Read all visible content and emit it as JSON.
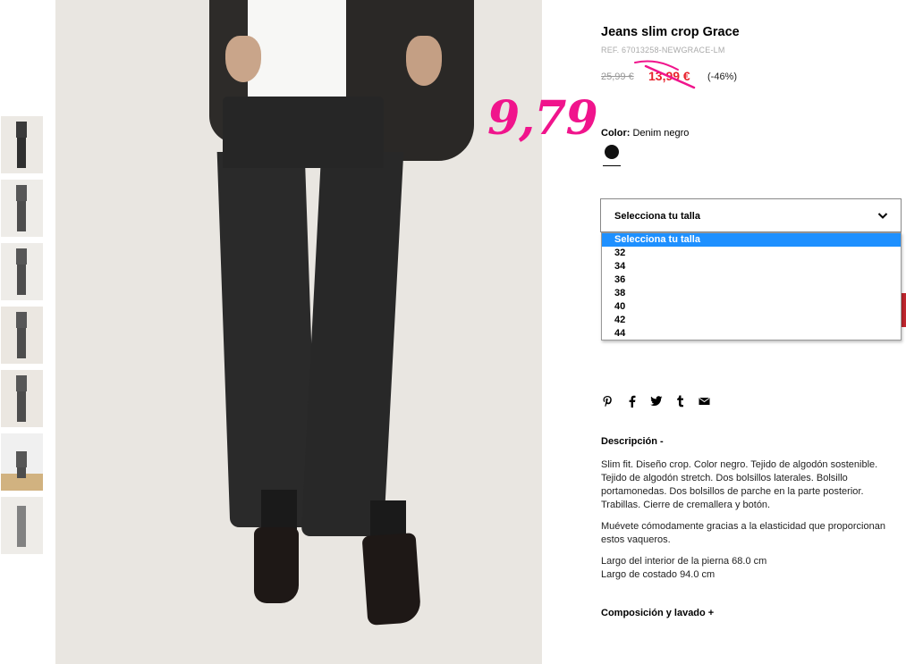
{
  "product": {
    "title": "Jeans slim crop Grace",
    "ref": "REF. 67013258-NEWGRACE-LM",
    "old_price": "25,99 €",
    "new_price": "13,99 €",
    "discount": "(-46%)",
    "handwritten_price": "9,79",
    "color_label": "Color:",
    "color_value": "Denim negro",
    "colors": {
      "swatch": "#111111",
      "price_red": "#e8232d",
      "handwritten": "#f0148c",
      "select_highlight": "#1e90ff"
    }
  },
  "size_select": {
    "label": "Selecciona tu talla",
    "options": [
      "Selecciona tu talla",
      "32",
      "34",
      "36",
      "38",
      "40",
      "42",
      "44"
    ],
    "selected_index": 0
  },
  "share_icons": [
    "pinterest-icon",
    "facebook-icon",
    "twitter-icon",
    "tumblr-icon",
    "email-icon"
  ],
  "description": {
    "title": "Descripción -",
    "paragraphs": [
      "Slim fit. Diseño crop. Color negro. Tejido de algodón sostenible. Tejido de algodón stretch. Dos bolsillos laterales. Bolsillo portamonedas. Dos bolsillos de parche en la parte posterior. Trabillas. Cierre de cremallera y botón.",
      "Muévete cómodamente gracias a la elasticidad que proporcionan estos vaqueros."
    ],
    "measure_1": "Largo del interior de la pierna 68.0 cm",
    "measure_2": "Largo de costado 94.0 cm"
  },
  "composition": {
    "title": "Composición y lavado +"
  },
  "gallery": {
    "thumbnail_count": 7,
    "active_index": 0
  }
}
